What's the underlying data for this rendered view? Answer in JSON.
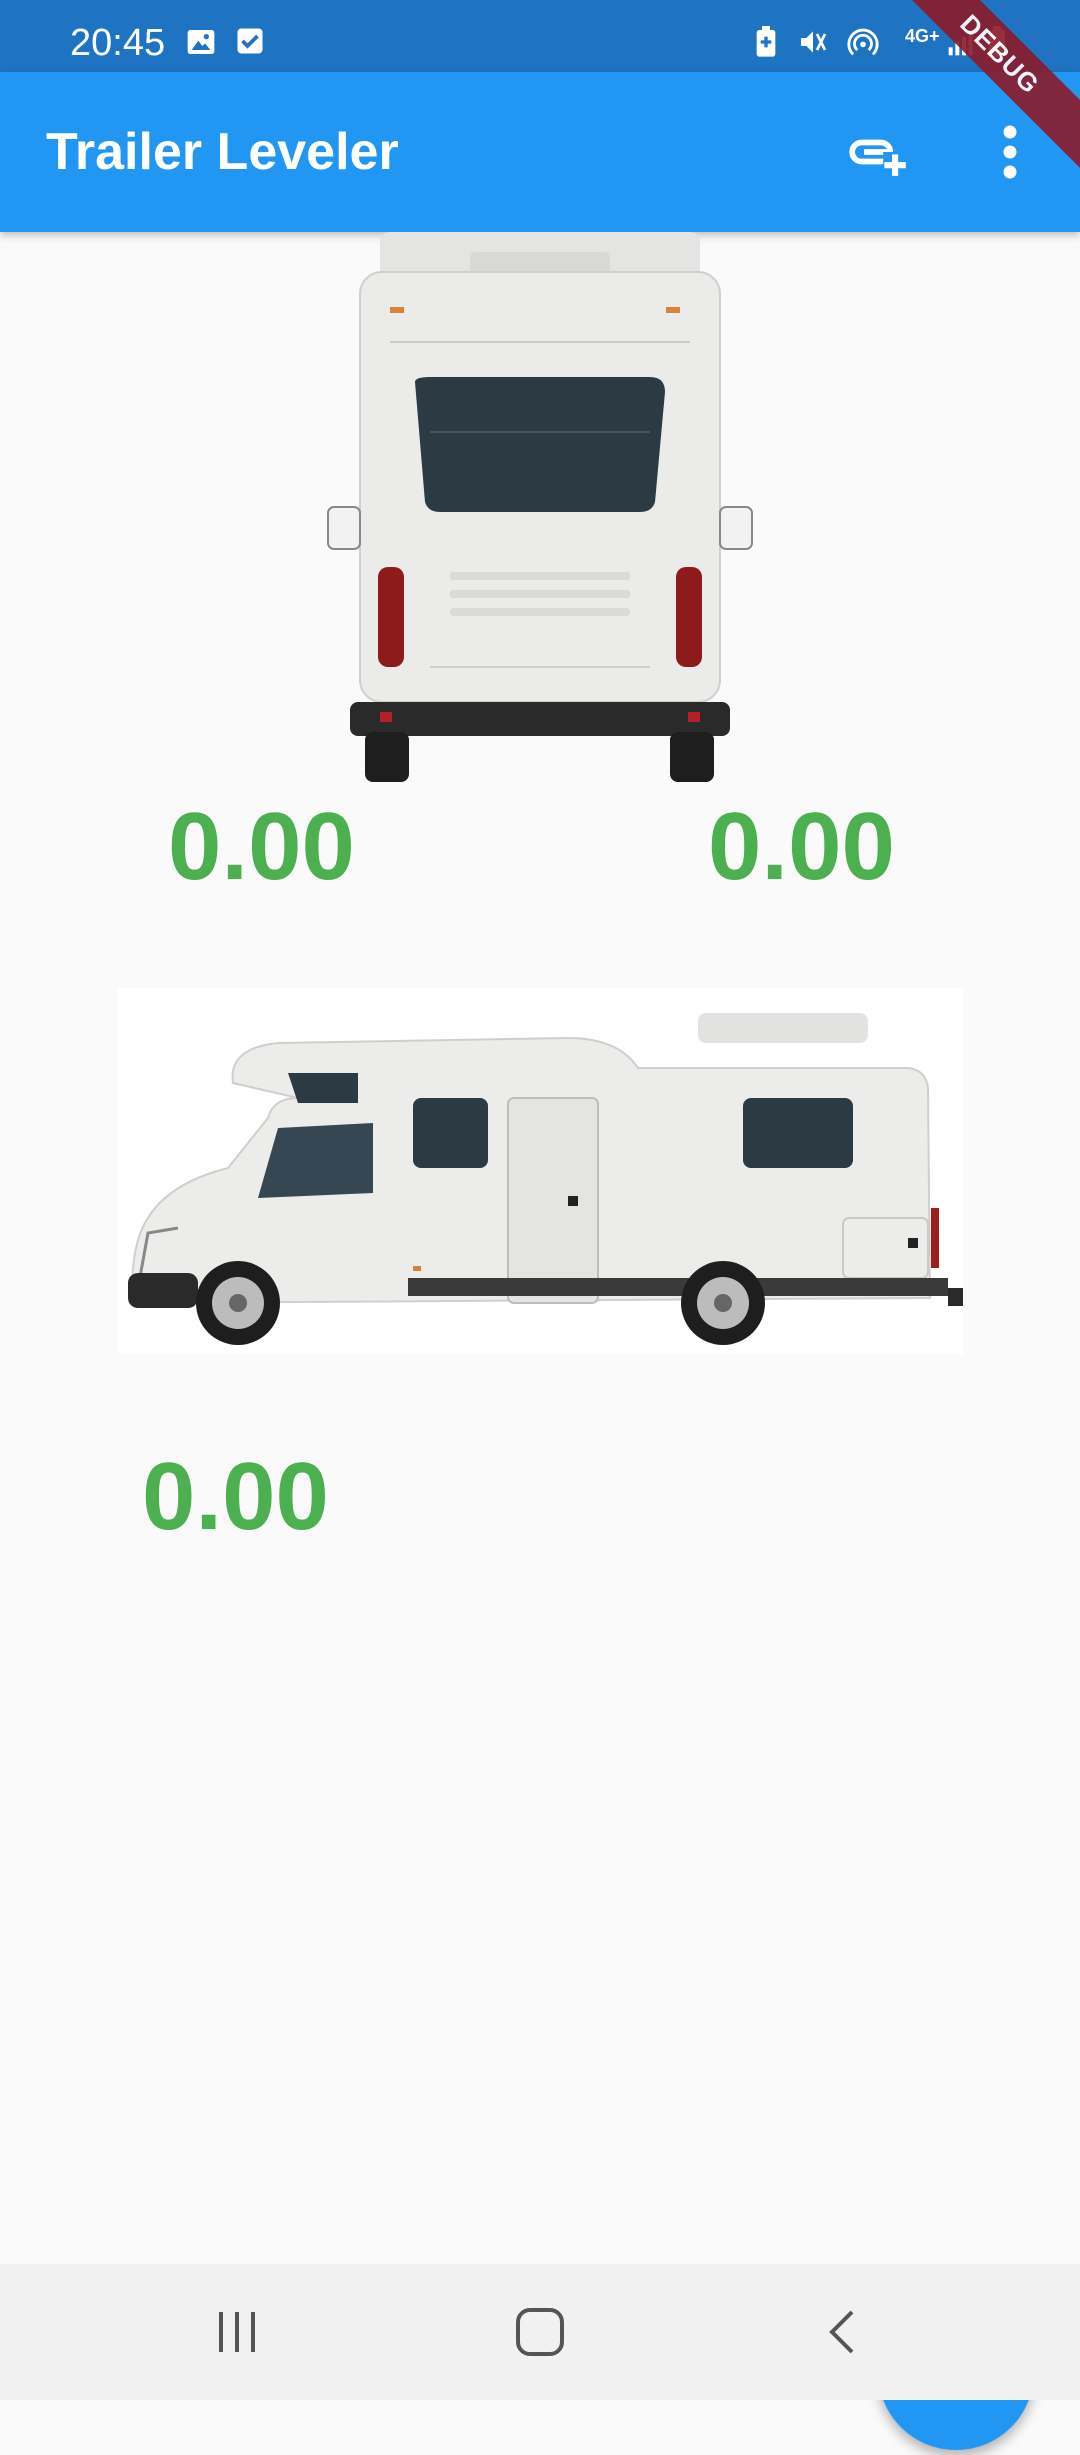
{
  "status_bar": {
    "time": "20:45",
    "left_icons": [
      "image-icon",
      "checkbox-icon"
    ],
    "right_icons": [
      "battery-saver-icon",
      "mute-vibrate-icon",
      "hotspot-icon",
      "signal-4g-icon",
      "battery-icon"
    ],
    "network_label": "4G+"
  },
  "debug_banner": "DEBUG",
  "app_bar": {
    "title": "Trailer Leveler",
    "actions": [
      "add-link-icon",
      "more-vert-icon"
    ]
  },
  "levels": {
    "rear_left": "0.00",
    "rear_right": "0.00",
    "side": "0.00"
  },
  "images": {
    "rear_view": "rv-rear-view",
    "side_view": "rv-side-view"
  },
  "fab": {
    "icon": "add-icon"
  },
  "nav_bar": {
    "buttons": [
      "recent-apps-icon",
      "home-icon",
      "back-icon"
    ]
  },
  "colors": {
    "status_bar": "#1e74c2",
    "app_bar": "#2196f3",
    "level_value": "#4caf50",
    "fab": "#2196f3",
    "background": "#fafafa"
  }
}
